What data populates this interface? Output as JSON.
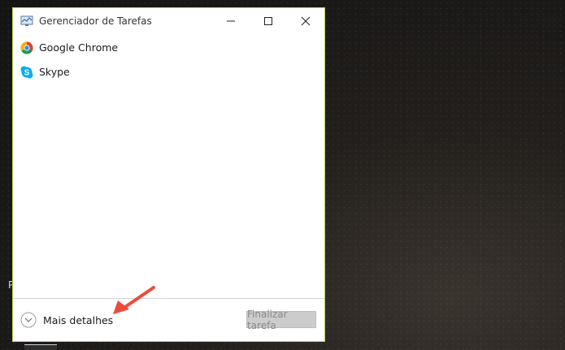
{
  "window": {
    "title": "Gerenciador de Tarefas",
    "icon": "task-manager-icon",
    "controls": [
      "minimize-icon",
      "maximize-icon",
      "close-icon"
    ]
  },
  "apps": [
    {
      "label": "Google Chrome",
      "icon": "chrome-icon"
    },
    {
      "label": "Skype",
      "icon": "skype-icon"
    }
  ],
  "footer": {
    "more_details_label": "Mais detalhes",
    "end_task_label": "Finalizar tarefa"
  },
  "colors": {
    "window_border": "#b7d65a",
    "annotation_arrow": "#f04a3a",
    "skype_blue": "#00aff0"
  }
}
